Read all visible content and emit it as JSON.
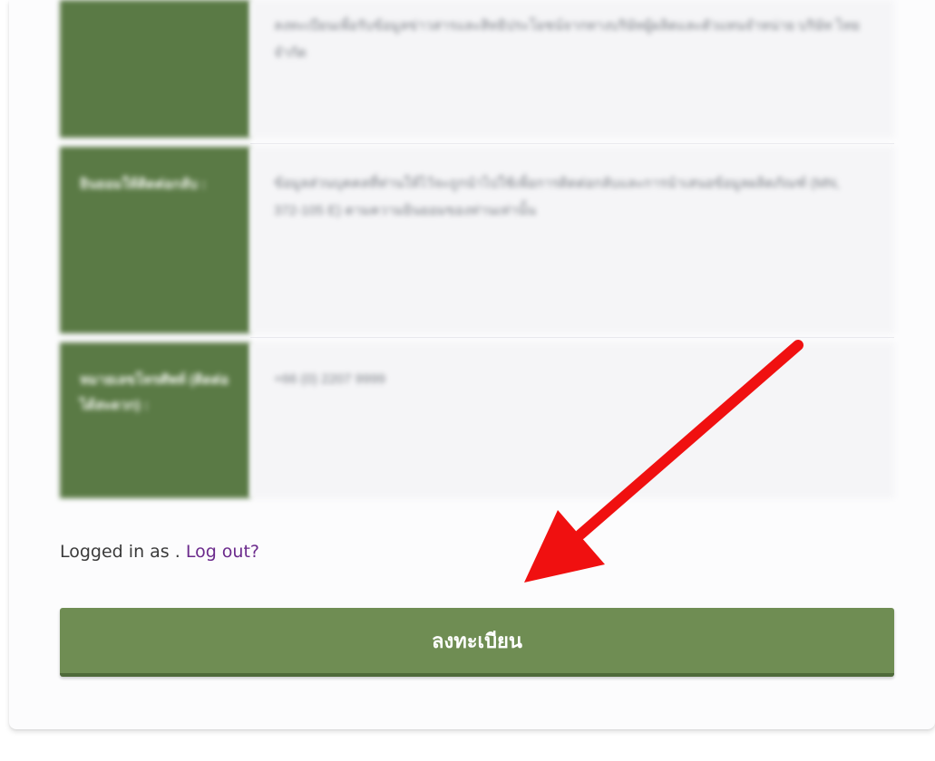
{
  "info_rows": [
    {
      "label": "",
      "value": "ลงทะเบียนเพื่อรับข้อมูลข่าวสารและสิทธิประโยชน์จากทางบริษัทผู้ผลิตและตัวแทนจำหน่าย บริษัท ไทย จำกัด"
    },
    {
      "label": "ยินยอมให้ติดต่อกลับ :",
      "value": "ข้อมูลส่วนบุคคลที่ท่านให้ไว้จะถูกนำไปใช้เพื่อการติดต่อกลับและการนำเสนอข้อมูลผลิตภัณฑ์ (MN, 372-105 E) ตามความยินยอมของท่านเท่านั้น"
    },
    {
      "label": "หมายเลขโทรศัพท์ (ติดต่อได้สะดวก) :",
      "value": "+66 (0) 2207 9999"
    }
  ],
  "login": {
    "prefix": "Logged in as . ",
    "logout_link": "Log out?"
  },
  "register_button": {
    "label": "ลงทะเบียน"
  },
  "colors": {
    "label_bg": "#5a7a45",
    "button_bg": "#6f8d53",
    "arrow": "#f01010",
    "link": "#6b2a8c"
  },
  "annotation_icon": "red-arrow-icon"
}
